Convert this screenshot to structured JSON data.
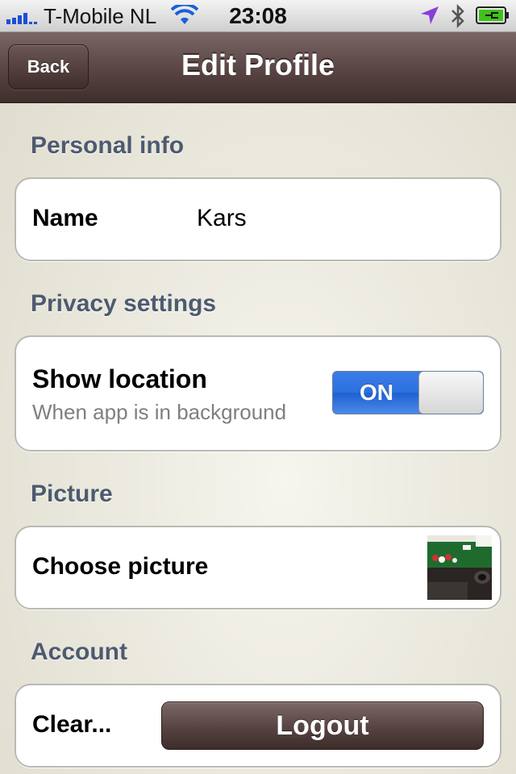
{
  "status_bar": {
    "carrier": "T-Mobile NL",
    "time": "23:08",
    "icons": [
      "signal-icon",
      "wifi-icon",
      "location-arrow-icon",
      "bluetooth-icon",
      "battery-charging-icon"
    ]
  },
  "nav": {
    "back_label": "Back",
    "title": "Edit Profile"
  },
  "sections": {
    "personal": {
      "header": "Personal info",
      "name_label": "Name",
      "name_value": "Kars"
    },
    "privacy": {
      "header": "Privacy settings",
      "location_label": "Show location",
      "location_sub": "When app is in background",
      "toggle_label": "ON",
      "toggle_on": true
    },
    "picture": {
      "header": "Picture",
      "choose_label": "Choose picture"
    },
    "account": {
      "header": "Account",
      "clear_label": "Clear...",
      "logout_label": "Logout"
    }
  },
  "colors": {
    "nav_brown": "#5b4745",
    "section_header": "#4d5a70",
    "toggle_blue": "#2c6fe0"
  }
}
